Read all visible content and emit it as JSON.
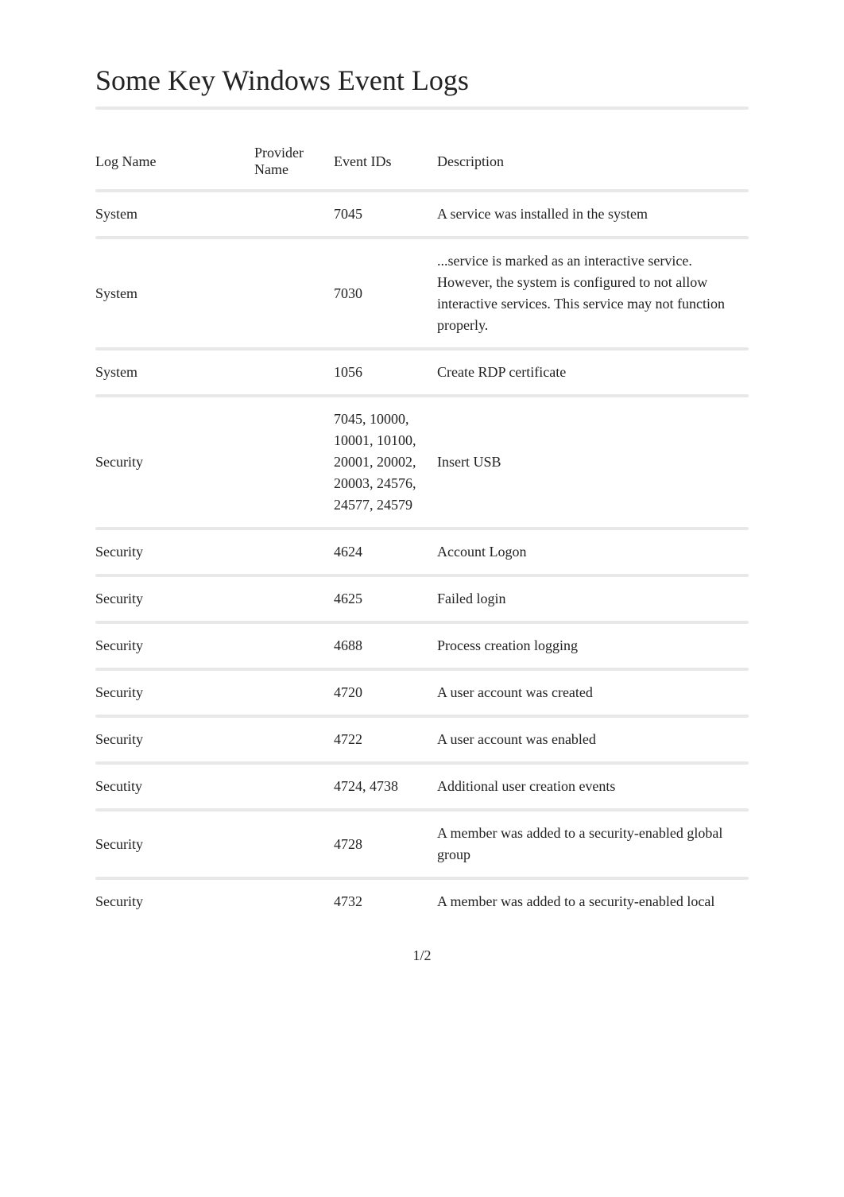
{
  "title": "Some Key Windows Event Logs",
  "columns": {
    "logname": "Log Name",
    "provider": "Provider Name",
    "eventids": "Event IDs",
    "description": "Description"
  },
  "rows": [
    {
      "logname": "System",
      "provider": "",
      "eventids": "7045",
      "description": "A service was installed in the system"
    },
    {
      "logname": "System",
      "provider": "",
      "eventids": "7030",
      "description": "...service is marked as an interactive service. However, the system is configured to not allow interactive services. This service may not function properly."
    },
    {
      "logname": "System",
      "provider": "",
      "eventids": "1056",
      "description": "Create RDP certificate"
    },
    {
      "logname": "Security",
      "provider": "",
      "eventids": "7045, 10000, 10001, 10100, 20001, 20002, 20003, 24576, 24577, 24579",
      "description": "Insert USB"
    },
    {
      "logname": "Security",
      "provider": "",
      "eventids": "4624",
      "description": "Account Logon"
    },
    {
      "logname": "Security",
      "provider": "",
      "eventids": "4625",
      "description": "Failed login"
    },
    {
      "logname": "Security",
      "provider": "",
      "eventids": "4688",
      "description": "Process creation logging"
    },
    {
      "logname": "Security",
      "provider": "",
      "eventids": "4720",
      "description": "A user account was created"
    },
    {
      "logname": "Security",
      "provider": "",
      "eventids": "4722",
      "description": "A user account was enabled"
    },
    {
      "logname": "Secutity",
      "provider": "",
      "eventids": "4724, 4738",
      "description": "Additional user creation events"
    },
    {
      "logname": "Security",
      "provider": "",
      "eventids": "4728",
      "description": "A member was added to a security-enabled global group"
    },
    {
      "logname": "Security",
      "provider": "",
      "eventids": "4732",
      "description": "A member was added to a security-enabled local"
    }
  ],
  "page_number": "1/2"
}
